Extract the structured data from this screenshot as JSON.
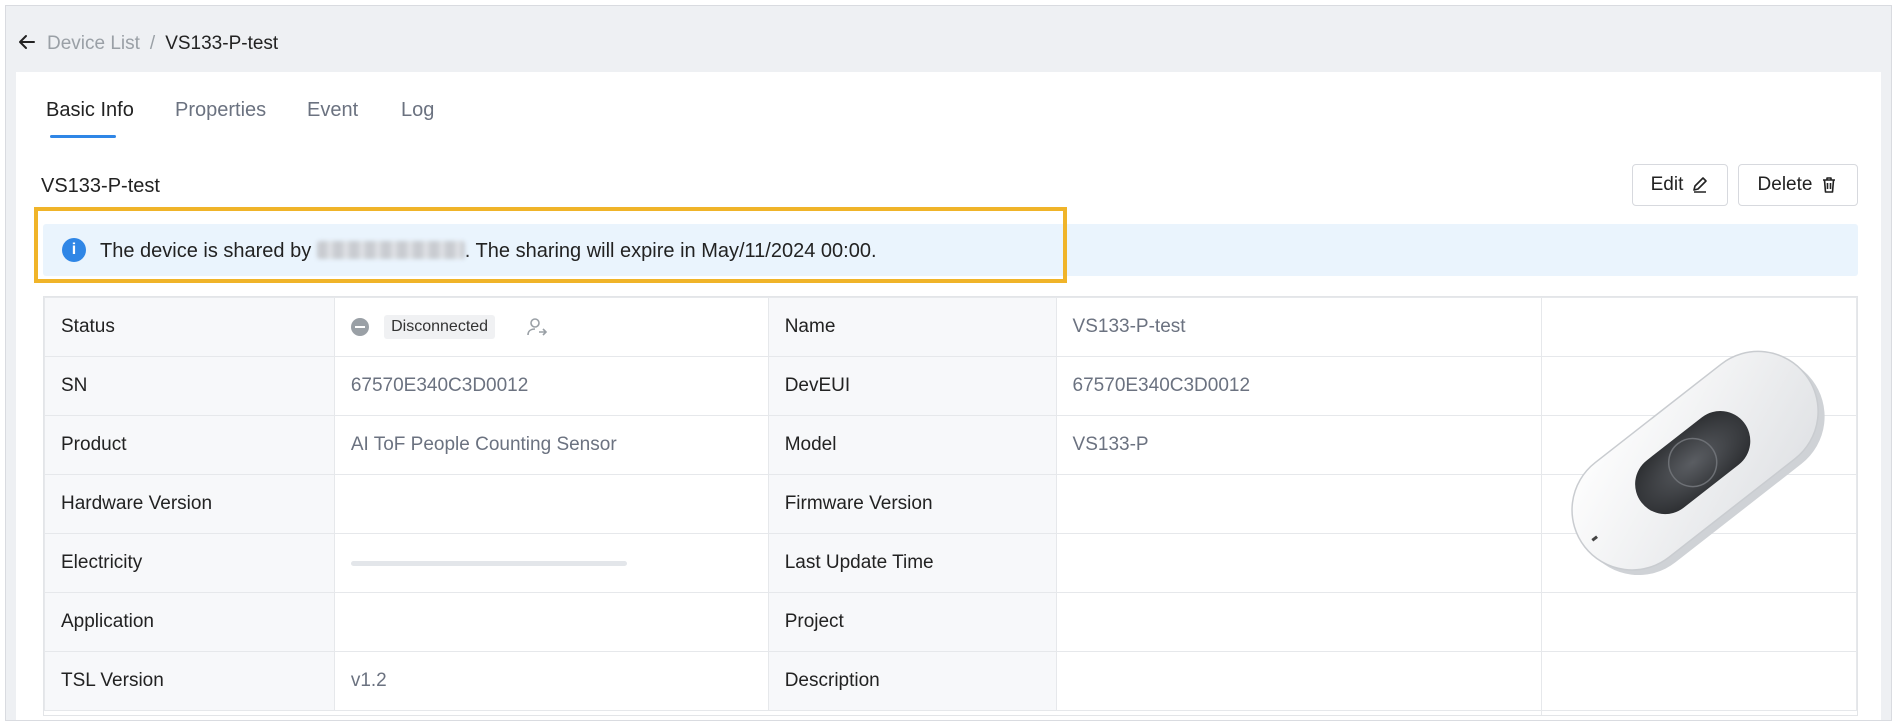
{
  "breadcrumb": {
    "parent": "Device List",
    "separator": "/",
    "current": "VS133-P-test"
  },
  "tabs": [
    {
      "label": "Basic Info",
      "active": true
    },
    {
      "label": "Properties",
      "active": false
    },
    {
      "label": "Event",
      "active": false
    },
    {
      "label": "Log",
      "active": false
    }
  ],
  "device": {
    "title": "VS133-P-test"
  },
  "actions": {
    "edit_label": "Edit",
    "delete_label": "Delete"
  },
  "alert": {
    "prefix": "The device is shared by",
    "suffix": ". The sharing will expire in May/11/2024 00:00."
  },
  "details": {
    "status_label": "Status",
    "status_value": "Disconnected",
    "name_label": "Name",
    "name_value": "VS133-P-test",
    "sn_label": "SN",
    "sn_value": "67570E340C3D0012",
    "deveui_label": "DevEUI",
    "deveui_value": "67570E340C3D0012",
    "product_label": "Product",
    "product_value": "AI ToF People Counting Sensor",
    "model_label": "Model",
    "model_value": "VS133-P",
    "hw_label": "Hardware Version",
    "hw_value": "",
    "fw_label": "Firmware Version",
    "fw_value": "",
    "electricity_label": "Electricity",
    "electricity_level": 0,
    "last_update_label": "Last Update Time",
    "last_update_value": "",
    "application_label": "Application",
    "application_value": "",
    "project_label": "Project",
    "project_value": "",
    "tsl_label": "TSL Version",
    "tsl_value": "v1.2",
    "description_label": "Description",
    "description_value": ""
  },
  "colors": {
    "accent": "#2f86e6",
    "highlight_border": "#f0b429",
    "alert_bg": "#eaf4fd"
  },
  "icons": {
    "back": "arrow-left-icon",
    "edit": "pencil-icon",
    "delete": "trash-icon",
    "info": "info-icon",
    "status": "minus-circle-icon",
    "user": "user-transfer-icon"
  }
}
